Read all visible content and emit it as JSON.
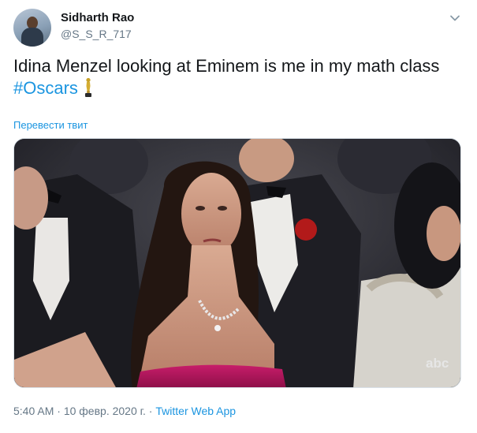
{
  "user": {
    "name": "Sidharth Rao",
    "handle": "@S_S_R_717"
  },
  "tweet": {
    "text": "Idina Menzel looking at Eminem is me in my math class",
    "hashtag": "#Oscars",
    "translate_label": "Перевести твит"
  },
  "media": {
    "watermark": "abc"
  },
  "meta": {
    "time": "5:40 AM",
    "separator": " · ",
    "date": "10 февр. 2020 г.",
    "separator2": " · ",
    "source": "Twitter Web App"
  },
  "icons": {
    "menu": "chevron-down-icon",
    "emoji": "trophy-icon"
  },
  "colors": {
    "link": "#1b95e0",
    "secondary_text": "#657786",
    "primary_text": "#14171a"
  }
}
